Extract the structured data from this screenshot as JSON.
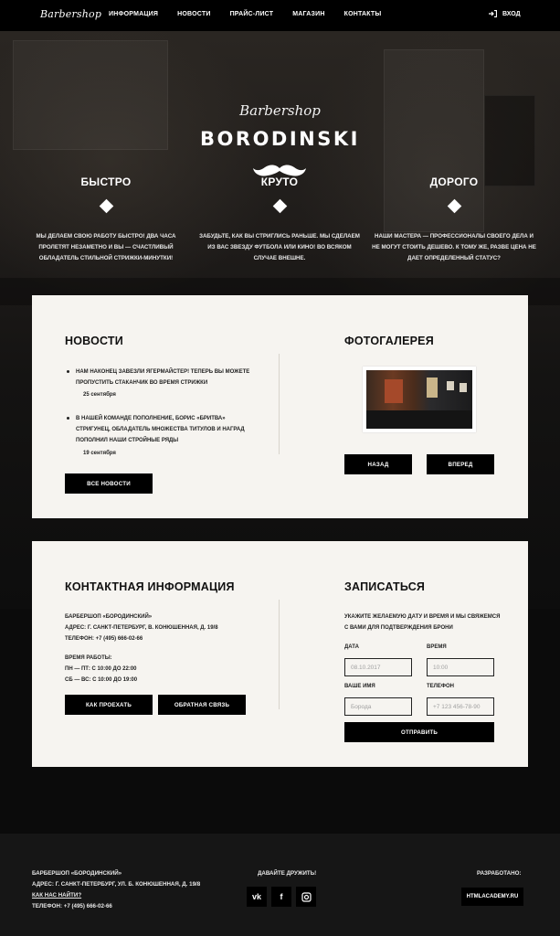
{
  "nav": {
    "logo": "Barbershop",
    "items": [
      "ИНФОРМАЦИЯ",
      "НОВОСТИ",
      "ПРАЙС-ЛИСТ",
      "МАГАЗИН",
      "КОНТАКТЫ"
    ],
    "login": "ВХОД"
  },
  "hero": {
    "script": "Barbershop",
    "name": "BORODINSKI",
    "features": [
      {
        "title": "БЫСТРО",
        "text": "МЫ ДЕЛАЕМ СВОЮ РАБОТУ БЫСТРО! ДВА ЧАСА ПРОЛЕТЯТ НЕЗАМЕТНО И ВЫ — СЧАСТЛИВЫЙ ОБЛАДАТЕЛЬ СТИЛЬНОЙ СТРИЖКИ-МИНУТКИ!"
      },
      {
        "title": "КРУТО",
        "text": "ЗАБУДЬТЕ, КАК ВЫ СТРИГЛИСЬ РАНЬШЕ. МЫ СДЕЛАЕМ ИЗ ВАС ЗВЕЗДУ ФУТБОЛА ИЛИ КИНО! ВО ВСЯКОМ СЛУЧАЕ ВНЕШНЕ."
      },
      {
        "title": "ДОРОГО",
        "text": "НАШИ МАСТЕРА — ПРОФЕССИОНАЛЫ СВОЕГО ДЕЛА И НЕ МОГУТ СТОИТЬ ДЕШЕВО. К ТОМУ ЖЕ, РАЗВЕ ЦЕНА НЕ ДАЕТ ОПРЕДЕЛЕННЫЙ СТАТУС?"
      }
    ]
  },
  "news": {
    "title": "НОВОСТИ",
    "items": [
      {
        "text": "НАМ НАКОНЕЦ ЗАВЕЗЛИ ЯГЕРМАЙСТЕР! ТЕПЕРЬ ВЫ МОЖЕТЕ ПРОПУСТИТЬ СТАКАНЧИК ВО ВРЕМЯ СТРИЖКИ",
        "date": "25 сентября"
      },
      {
        "text": "В НАШЕЙ КОМАНДЕ ПОПОЛНЕНИЕ, БОРИС «БРИТВА» СТРИГУНЕЦ, ОБЛАДАТЕЛЬ МНОЖЕСТВА ТИТУЛОВ И НАГРАД ПОПОЛНИЛ НАШИ СТРОЙНЫЕ РЯДЫ",
        "date": "19 сентября"
      }
    ],
    "all_button": "ВСЕ НОВОСТИ"
  },
  "gallery": {
    "title": "ФОТОГАЛЕРЕЯ",
    "prev": "НАЗАД",
    "next": "ВПЕРЕД"
  },
  "contacts": {
    "title": "КОНТАКТНАЯ ИНФОРМАЦИЯ",
    "name": "БАРБЕРШОП «БОРОДИНСКИЙ»",
    "address": "АДРЕС: Г. САНКТ-ПЕТЕРБУРГ, В. КОНЮШЕННАЯ, Д. 19/8",
    "phone": "ТЕЛЕФОН: +7 (495) 666-02-66",
    "hours_title": "ВРЕМЯ РАБОТЫ:",
    "hours_weekdays": "ПН — ПТ: С 10:00 ДО 22:00",
    "hours_weekend": "СБ — ВС: С 10:00 ДО 19:00",
    "route_button": "КАК ПРОЕХАТЬ",
    "feedback_button": "ОБРАТНАЯ СВЯЗЬ"
  },
  "booking": {
    "title": "ЗАПИСАТЬСЯ",
    "intro": "УКАЖИТЕ ЖЕЛАЕМУЮ ДАТУ И ВРЕМЯ И МЫ СВЯЖЕМСЯ С ВАМИ ДЛЯ ПОДТВЕРЖДЕНИЯ БРОНИ",
    "date_label": "ДАТА",
    "date_value": "08.10.2017",
    "time_label": "ВРЕМЯ",
    "time_value": "10:00",
    "name_label": "ВАШЕ ИМЯ",
    "name_placeholder": "Борода",
    "phone_label": "ТЕЛЕФОН",
    "phone_placeholder": "+7 123 456-78-90",
    "submit": "ОТПРАВИТЬ"
  },
  "footer": {
    "name": "БАРБЕРШОП «БОРОДИНСКИЙ»",
    "address": "АДРЕС: Г. САНКТ-ПЕТЕРБУРГ, УЛ. Б. КОНЮШЕННАЯ, Д. 19/8",
    "route_link": "КАК НАС НАЙТИ?",
    "phone": "ТЕЛЕФОН: +7 (495) 666-02-66",
    "social_title": "ДАВАЙТЕ ДРУЖИТЬ!",
    "social": [
      "vk-icon",
      "facebook-icon",
      "instagram-icon"
    ],
    "dev_title": "РАЗРАБОТАНО:",
    "dev_button": "HTMLACADEMY.RU"
  }
}
